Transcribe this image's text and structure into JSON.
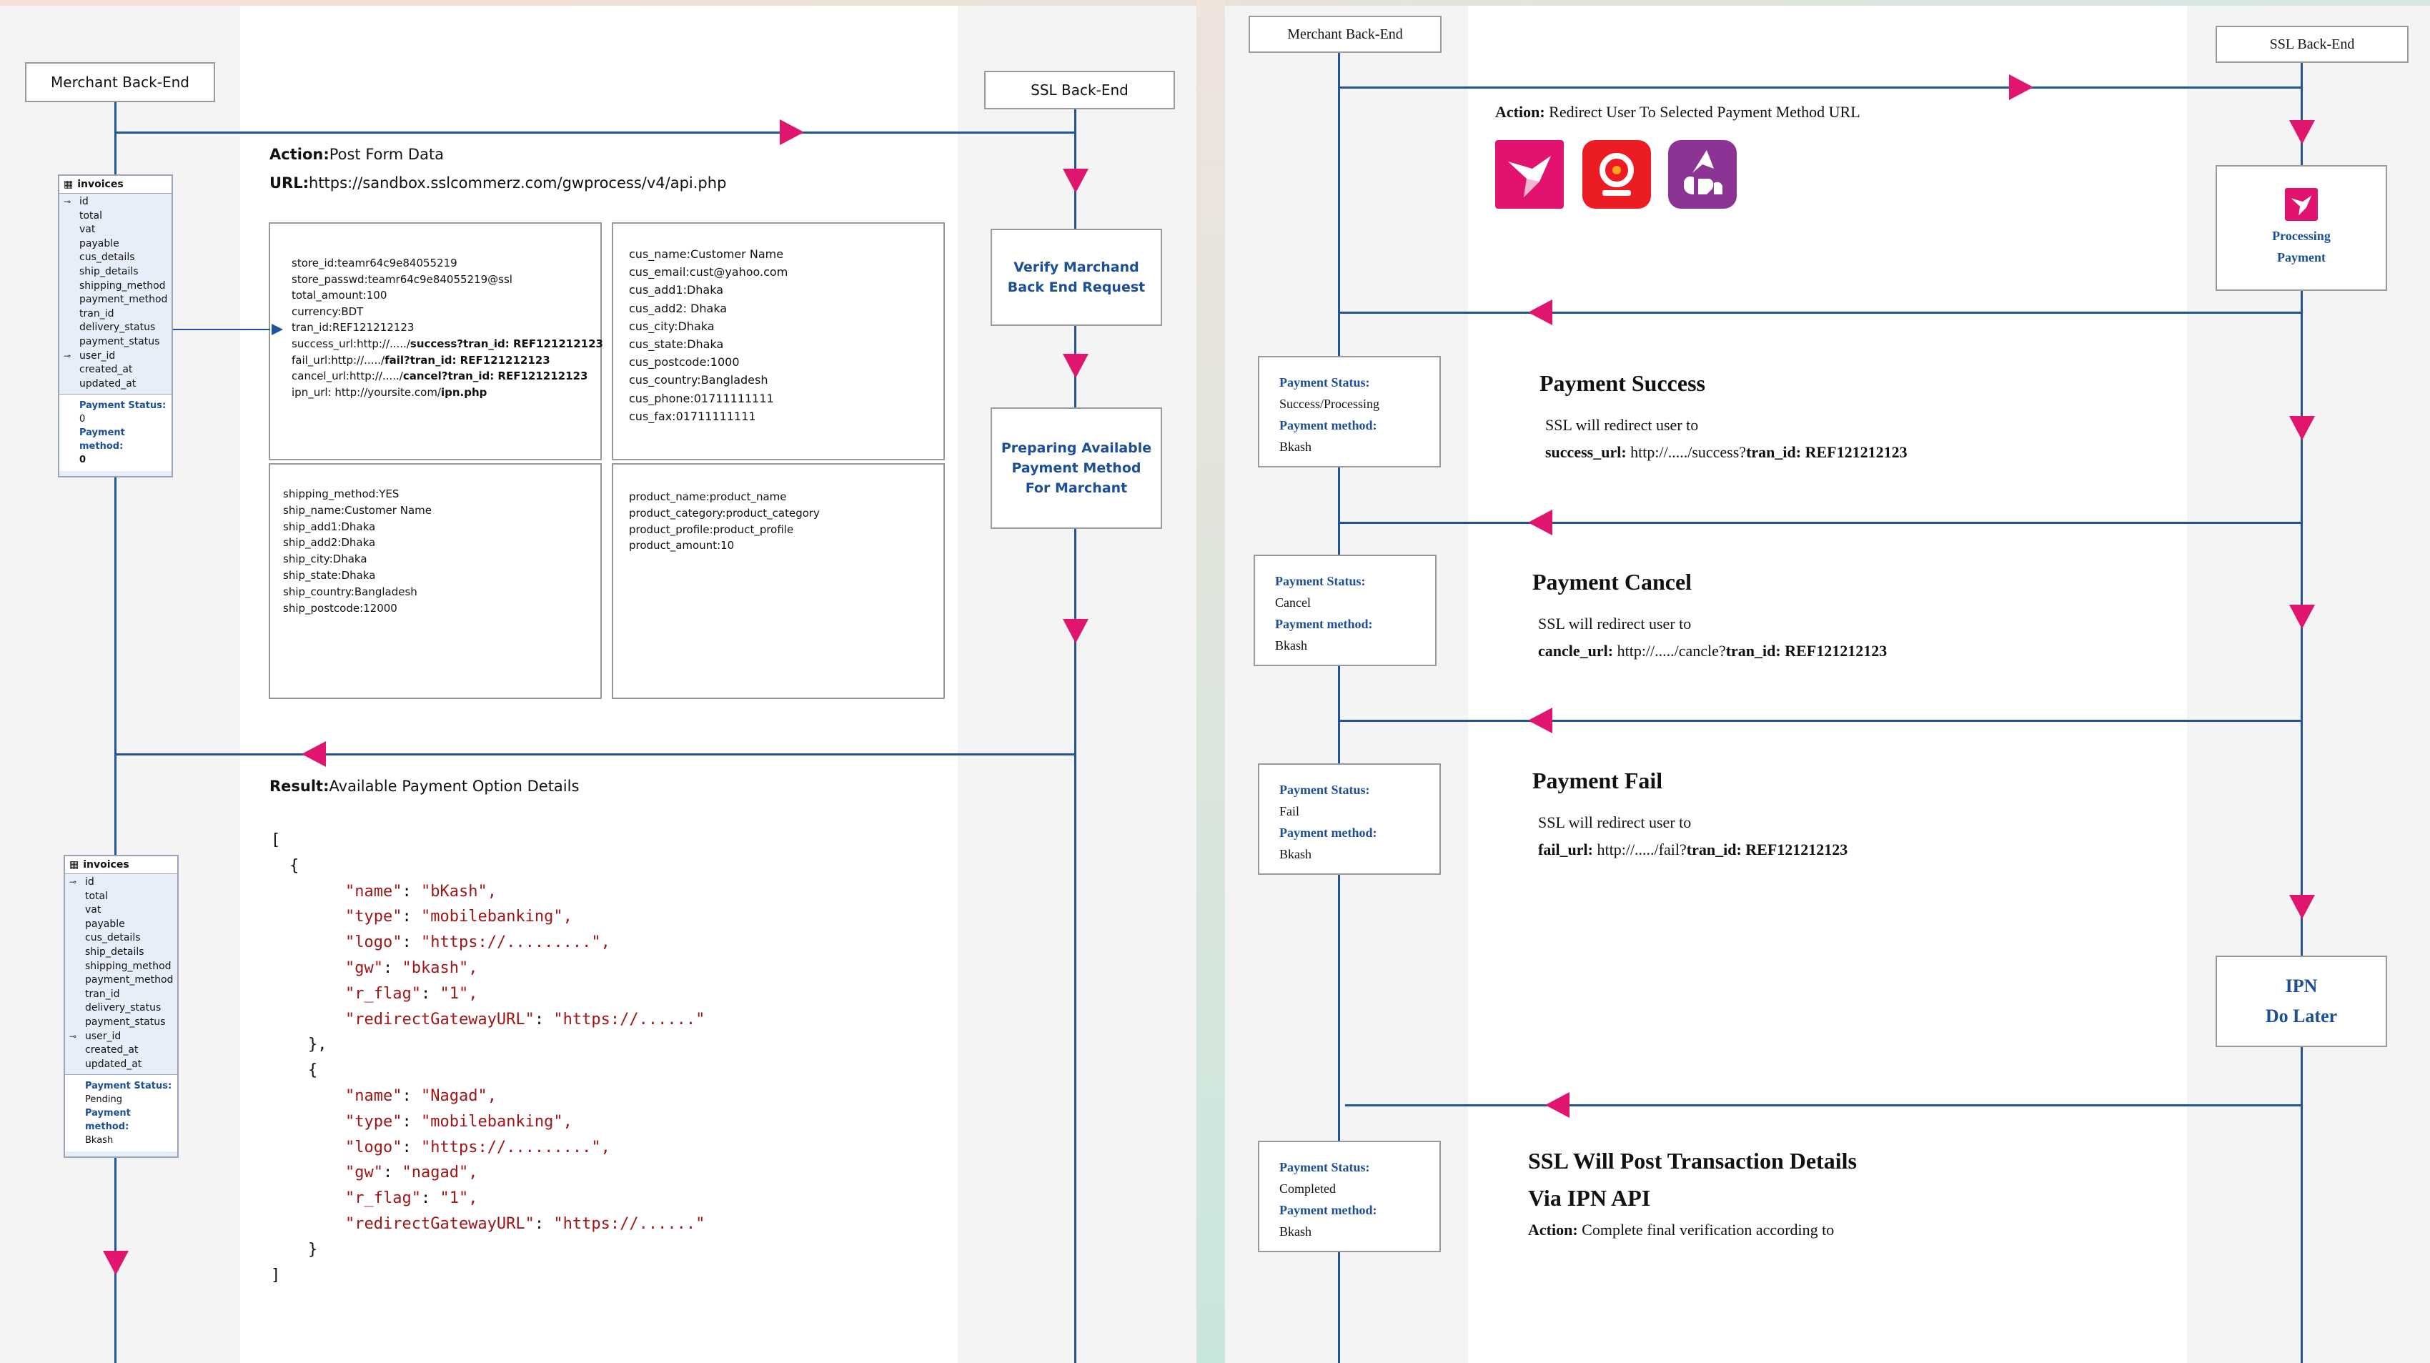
{
  "left": {
    "actors": {
      "merchant": "Merchant Back-End",
      "ssl": "SSL Back-End"
    },
    "action_label": "Action:",
    "action_text": "Post Form Data",
    "url_label": "URL:",
    "url_text": "https://sandbox.sslcommerz.com/gwprocess/v4/api.php",
    "verify_box": [
      "Verify Marchand",
      "Back End Request"
    ],
    "prepare_box": [
      "Preparing Available",
      "Payment Method",
      "For Marchant"
    ],
    "result_label": "Result:",
    "result_text": "Available Payment Option Details",
    "table_title": "invoices",
    "table_fields": [
      "id",
      "total",
      "vat",
      "payable",
      "cus_details",
      "ship_details",
      "shipping_method",
      "payment_method",
      "tran_id",
      "delivery_status",
      "payment_status",
      "user_id",
      "created_at",
      "updated_at"
    ],
    "table1_foot": {
      "status_label": "Payment Status:",
      "status_value": "0",
      "method_label": "Payment method:",
      "method_value": "0"
    },
    "table2_foot": {
      "status_label": "Payment Status:",
      "status_value": "Pending",
      "method_label": "Payment method:",
      "method_value": "Bkash"
    },
    "card1": {
      "lines": [
        "store_id:teamr64c9e84055219",
        "store_passwd:teamr64c9e84055219@ssl",
        "total_amount:100",
        "currency:BDT",
        "tran_id:REF121212123"
      ],
      "success_pre": "success_url:http://...../",
      "success_bold": "success?tran_id: REF121212123",
      "fail_pre": "fail_url:http://...../",
      "fail_bold": "fail?tran_id: REF121212123",
      "cancel_pre": "cancel_url:http://...../",
      "cancel_bold": "cancel?tran_id: REF121212123",
      "ipn_pre": "ipn_url: http://yoursite.com/",
      "ipn_bold": "ipn.php"
    },
    "card2": [
      "cus_name:Customer Name",
      "cus_email:cust@yahoo.com",
      "cus_add1:Dhaka",
      "cus_add2: Dhaka",
      "cus_city:Dhaka",
      "cus_state:Dhaka",
      "cus_postcode:1000",
      "cus_country:Bangladesh",
      "cus_phone:01711111111",
      "cus_fax:01711111111"
    ],
    "card3": [
      "shipping_method:YES",
      "ship_name:Customer Name",
      "ship_add1:Dhaka",
      "ship_add2:Dhaka",
      "ship_city:Dhaka",
      "ship_state:Dhaka",
      "ship_country:Bangladesh",
      "ship_postcode:12000"
    ],
    "card4": [
      "product_name:product_name",
      "product_category:product_category",
      "product_profile:product_profile",
      "product_amount:10"
    ],
    "json_lines": [
      {
        "indent": 0,
        "text": "["
      },
      {
        "indent": 1,
        "text": "{"
      },
      {
        "indent": 4,
        "k": "\"name\"",
        "v": "\"bKash\","
      },
      {
        "indent": 4,
        "k": "\"type\"",
        "v": "\"mobilebanking\","
      },
      {
        "indent": 4,
        "k": "\"logo\"",
        "v": "\"https://.........\","
      },
      {
        "indent": 4,
        "k": "\"gw\"",
        "v": "\"bkash\","
      },
      {
        "indent": 4,
        "k": "\"r_flag\"",
        "v": "\"1\","
      },
      {
        "indent": 4,
        "k": "\"redirectGatewayURL\"",
        "v": "\"https://......\""
      },
      {
        "indent": 2,
        "text": "},"
      },
      {
        "indent": 2,
        "text": "{"
      },
      {
        "indent": 4,
        "k": "\"name\"",
        "v": "\"Nagad\","
      },
      {
        "indent": 4,
        "k": "\"type\"",
        "v": "\"mobilebanking\","
      },
      {
        "indent": 4,
        "k": "\"logo\"",
        "v": "\"https://.........\","
      },
      {
        "indent": 4,
        "k": "\"gw\"",
        "v": "\"nagad\","
      },
      {
        "indent": 4,
        "k": "\"r_flag\"",
        "v": "\"1\","
      },
      {
        "indent": 4,
        "k": "\"redirectGatewayURL\"",
        "v": "\"https://......\""
      },
      {
        "indent": 2,
        "text": "}"
      },
      {
        "indent": 0,
        "text": "]"
      }
    ]
  },
  "right": {
    "actors": {
      "merchant": "Merchant Back-End",
      "ssl": "SSL Back-End"
    },
    "action_label": "Action:",
    "action_text": "Redirect User To Selected Payment Method URL",
    "processing": [
      "Processing",
      "Payment"
    ],
    "ipn_box": [
      "IPN",
      "Do Later"
    ],
    "status_label": "Payment Status:",
    "method_label": "Payment method:",
    "statuses": [
      {
        "status": "Success/Processing",
        "method": "Bkash"
      },
      {
        "status": "Cancel",
        "method": "Bkash"
      },
      {
        "status": "Fail",
        "method": "Bkash"
      },
      {
        "status": "Completed",
        "method": "Bkash"
      }
    ],
    "success": {
      "title": "Payment Success",
      "line": "SSL will redirect user to",
      "key": "success_url:",
      "pre": "http://...../success?",
      "bold": "tran_id: REF121212123"
    },
    "cancel": {
      "title": "Payment Cancel",
      "line": "SSL will redirect user to",
      "key": "cancle_url:",
      "pre": "http://...../cancle?",
      "bold": "tran_id: REF121212123"
    },
    "fail": {
      "title": "Payment Fail",
      "line": "SSL will redirect user to",
      "key": "fail_url:",
      "pre": "http://...../fail?",
      "bold": "tran_id: REF121212123"
    },
    "ipn_title": [
      "SSL Will Post Transaction Details",
      "Via IPN API"
    ],
    "final_label": "Action:",
    "final_text": "Complete final verification according to",
    "colors": {
      "line": "#20549a",
      "arrow": "#e0166e",
      "bkash": "#e2136e",
      "nagad": "#ec1c24",
      "rocket": "#8c3494"
    }
  }
}
